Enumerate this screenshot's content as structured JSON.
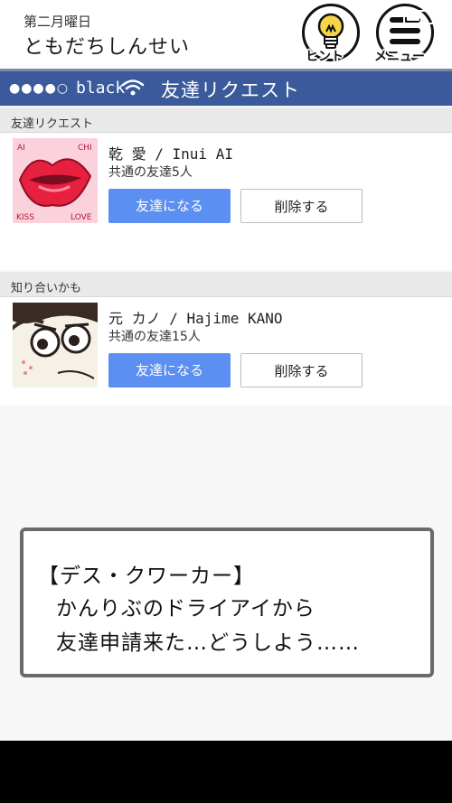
{
  "header": {
    "chapter": "第二月曜日",
    "title": "ともだちしんせい",
    "hint_label": "ヒント",
    "menu_label": "メニュー"
  },
  "status_bar": {
    "signal": "●●●●○",
    "carrier": "black",
    "screen_title": "友達リクエスト",
    "color": "#3a5a9c"
  },
  "sections": [
    {
      "heading": "友達リクエスト",
      "items": [
        {
          "name": "乾 愛 / Inui AI",
          "mutual": "共通の友達5人",
          "accept_label": "友達になる",
          "delete_label": "削除する",
          "avatar_text": [
            "AI",
            "CHI",
            "KISS",
            "LOVE"
          ]
        }
      ]
    },
    {
      "heading": "知り合いかも",
      "items": [
        {
          "name": "元 カノ / Hajime KANO",
          "mutual": "共通の友達15人",
          "accept_label": "友達になる",
          "delete_label": "削除する"
        }
      ]
    }
  ],
  "dialog": {
    "lines": [
      "【デス・クワーカー】",
      "かんりぶのドライアイから",
      "友達申請来た…どうしよう……"
    ]
  },
  "colors": {
    "primary_button": "#5b8ff1",
    "lips": "#e8203f"
  }
}
